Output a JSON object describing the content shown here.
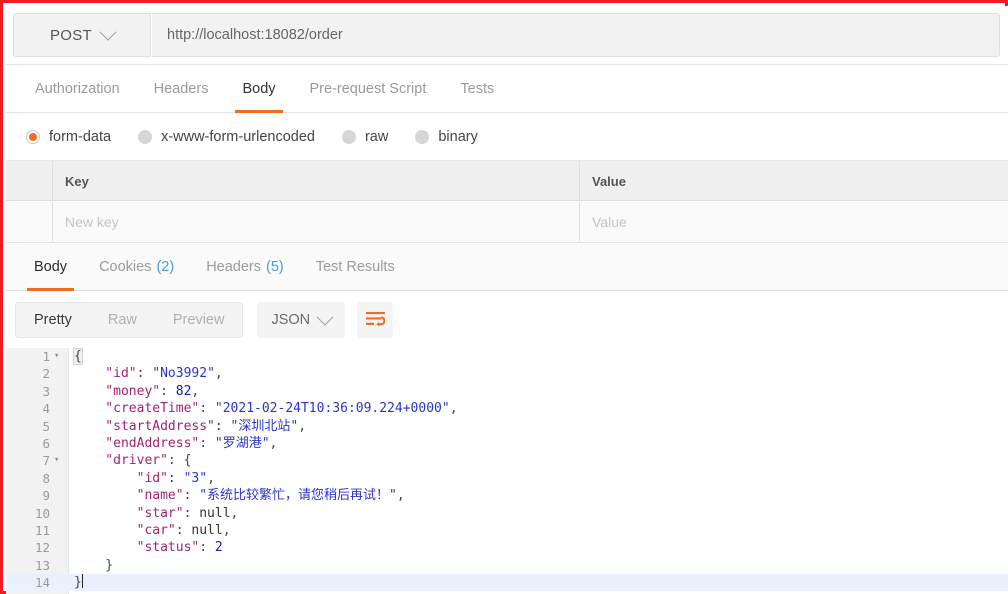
{
  "request": {
    "method": "POST",
    "method_chevron_icon": "chevron-down-icon",
    "url": "http://localhost:18082/order",
    "tabs": [
      {
        "label": "Authorization",
        "active": false
      },
      {
        "label": "Headers",
        "active": false
      },
      {
        "label": "Body",
        "active": true
      },
      {
        "label": "Pre-request Script",
        "active": false
      },
      {
        "label": "Tests",
        "active": false
      }
    ],
    "body_types": [
      {
        "label": "form-data",
        "selected": true
      },
      {
        "label": "x-www-form-urlencoded",
        "selected": false
      },
      {
        "label": "raw",
        "selected": false
      },
      {
        "label": "binary",
        "selected": false
      }
    ],
    "table": {
      "headers": {
        "key": "Key",
        "value": "Value"
      },
      "rows": [
        {
          "key_placeholder": "New key",
          "value_placeholder": "Value"
        }
      ]
    }
  },
  "response": {
    "tabs": [
      {
        "label": "Body",
        "count": "",
        "active": true
      },
      {
        "label": "Cookies",
        "count": "(2)",
        "active": false
      },
      {
        "label": "Headers",
        "count": "(5)",
        "active": false
      },
      {
        "label": "Test Results",
        "count": "",
        "active": false
      }
    ],
    "view_modes": [
      {
        "label": "Pretty",
        "active": true
      },
      {
        "label": "Raw",
        "active": false
      },
      {
        "label": "Preview",
        "active": false
      }
    ],
    "format": "JSON",
    "format_chevron_icon": "chevron-down-icon",
    "wrap_button_icon": "wrap-lines-icon",
    "code": {
      "language": "json",
      "lines": [
        {
          "num": "1",
          "fold": "▾",
          "active": false,
          "tokens": [
            {
              "t": "{",
              "c": "brace-hl p"
            }
          ]
        },
        {
          "num": "2",
          "fold": "",
          "active": false,
          "tokens": [
            {
              "t": "    \"id\"",
              "c": "k"
            },
            {
              "t": ": ",
              "c": "p"
            },
            {
              "t": "\"No3992\"",
              "c": "s"
            },
            {
              "t": ",",
              "c": "p"
            }
          ]
        },
        {
          "num": "3",
          "fold": "",
          "active": false,
          "tokens": [
            {
              "t": "    \"money\"",
              "c": "k"
            },
            {
              "t": ": ",
              "c": "p"
            },
            {
              "t": "82",
              "c": "n"
            },
            {
              "t": ",",
              "c": "p"
            }
          ]
        },
        {
          "num": "4",
          "fold": "",
          "active": false,
          "tokens": [
            {
              "t": "    \"createTime\"",
              "c": "k"
            },
            {
              "t": ": ",
              "c": "p"
            },
            {
              "t": "\"2021-02-24T10:36:09.224+0000\"",
              "c": "s"
            },
            {
              "t": ",",
              "c": "p"
            }
          ]
        },
        {
          "num": "5",
          "fold": "",
          "active": false,
          "tokens": [
            {
              "t": "    \"startAddress\"",
              "c": "k"
            },
            {
              "t": ": ",
              "c": "p"
            },
            {
              "t": "\"深圳北站\"",
              "c": "s"
            },
            {
              "t": ",",
              "c": "p"
            }
          ]
        },
        {
          "num": "6",
          "fold": "",
          "active": false,
          "tokens": [
            {
              "t": "    \"endAddress\"",
              "c": "k"
            },
            {
              "t": ": ",
              "c": "p"
            },
            {
              "t": "\"罗湖港\"",
              "c": "s"
            },
            {
              "t": ",",
              "c": "p"
            }
          ]
        },
        {
          "num": "7",
          "fold": "▾",
          "active": false,
          "tokens": [
            {
              "t": "    \"driver\"",
              "c": "k"
            },
            {
              "t": ": {",
              "c": "p"
            }
          ]
        },
        {
          "num": "8",
          "fold": "",
          "active": false,
          "tokens": [
            {
              "t": "        \"id\"",
              "c": "k"
            },
            {
              "t": ": ",
              "c": "p"
            },
            {
              "t": "\"3\"",
              "c": "s"
            },
            {
              "t": ",",
              "c": "p"
            }
          ]
        },
        {
          "num": "9",
          "fold": "",
          "active": false,
          "tokens": [
            {
              "t": "        \"name\"",
              "c": "k"
            },
            {
              "t": ": ",
              "c": "p"
            },
            {
              "t": "\"系统比较繁忙，请您稍后再试！\"",
              "c": "s"
            },
            {
              "t": ",",
              "c": "p"
            }
          ]
        },
        {
          "num": "10",
          "fold": "",
          "active": false,
          "tokens": [
            {
              "t": "        \"star\"",
              "c": "k"
            },
            {
              "t": ": ",
              "c": "p"
            },
            {
              "t": "null",
              "c": "nul"
            },
            {
              "t": ",",
              "c": "p"
            }
          ]
        },
        {
          "num": "11",
          "fold": "",
          "active": false,
          "tokens": [
            {
              "t": "        \"car\"",
              "c": "k"
            },
            {
              "t": ": ",
              "c": "p"
            },
            {
              "t": "null",
              "c": "nul"
            },
            {
              "t": ",",
              "c": "p"
            }
          ]
        },
        {
          "num": "12",
          "fold": "",
          "active": false,
          "tokens": [
            {
              "t": "        \"status\"",
              "c": "k"
            },
            {
              "t": ": ",
              "c": "p"
            },
            {
              "t": "2",
              "c": "n"
            }
          ]
        },
        {
          "num": "13",
          "fold": "",
          "active": false,
          "tokens": [
            {
              "t": "    }",
              "c": "p"
            }
          ]
        },
        {
          "num": "14",
          "fold": "",
          "active": true,
          "caret": true,
          "tokens": [
            {
              "t": "}",
              "c": "p"
            }
          ]
        }
      ]
    }
  },
  "colors": {
    "accent": "#ef6c1a",
    "annotation_border": "#ee1c25",
    "count_blue": "#4a9bdf",
    "json_key": "#a0246e",
    "json_string": "#2b35c9",
    "json_number": "#1a1aa6",
    "active_line": "#e8f2fd"
  }
}
